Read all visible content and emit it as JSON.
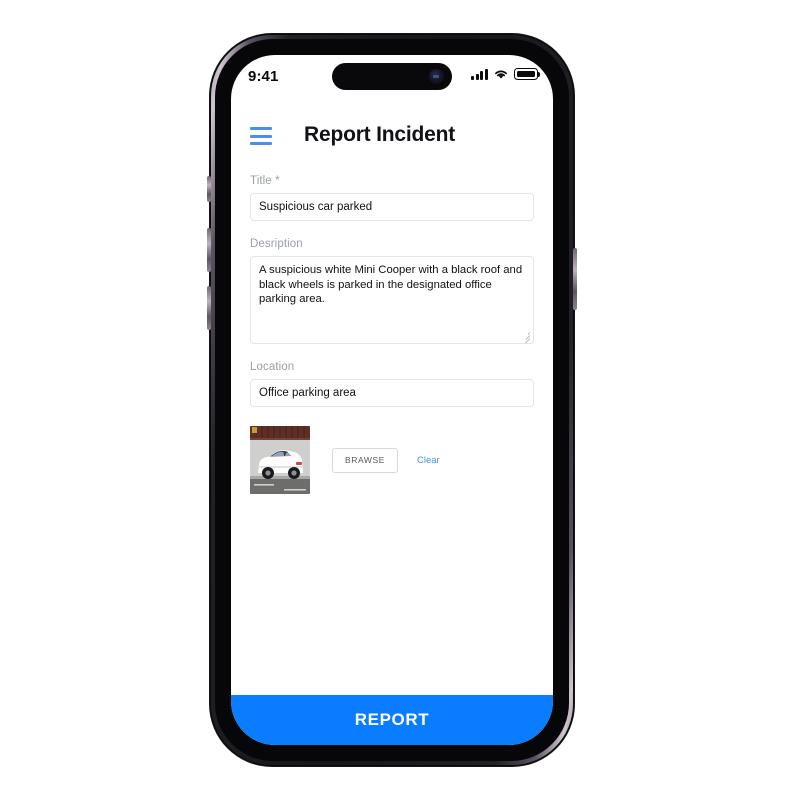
{
  "device": {
    "status_bar": {
      "time": "9:41",
      "signal_icon": "cellular-signal-icon",
      "wifi_icon": "wifi-icon",
      "battery_icon": "battery-icon"
    }
  },
  "app": {
    "header": {
      "menu_icon": "hamburger-menu-icon",
      "title": "Report Incident"
    },
    "form": {
      "title_field": {
        "label": "Title *",
        "value": "Suspicious car parked",
        "placeholder": ""
      },
      "description_field": {
        "label": "Desription",
        "value": "A suspicious white Mini Cooper with a black roof and black wheels is parked in the designated office parking area.",
        "placeholder": ""
      },
      "location_field": {
        "label": "Location",
        "value": "Office parking area",
        "placeholder": ""
      },
      "attachment": {
        "thumbnail_alt": "white-mini-cooper-parked-photo",
        "browse_label": "BRAWSE",
        "clear_label": "Clear"
      }
    },
    "submit": {
      "label": "REPORT"
    }
  },
  "colors": {
    "accent_blue": "#0a7cff",
    "link_blue": "#4a90e8",
    "label_grey": "#9aa0a6",
    "border_grey": "#e3e5e8",
    "text_dark": "#111114",
    "frame_black": "#0a0a0c"
  }
}
